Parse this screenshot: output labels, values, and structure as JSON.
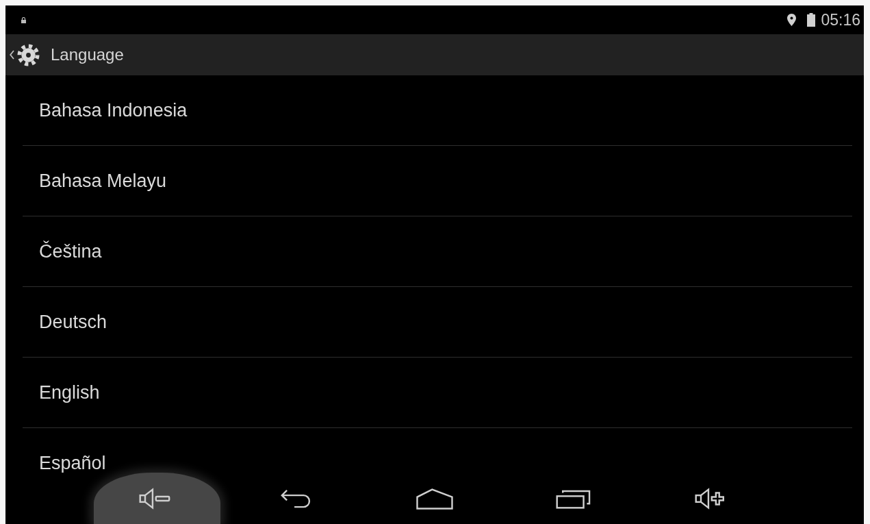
{
  "status_bar": {
    "time": "05:16"
  },
  "action_bar": {
    "title": "Language"
  },
  "languages": [
    {
      "label": "Bahasa Indonesia"
    },
    {
      "label": "Bahasa Melayu"
    },
    {
      "label": "Čeština"
    },
    {
      "label": "Deutsch"
    },
    {
      "label": "English"
    },
    {
      "label": "Español"
    }
  ],
  "nav_bar": {
    "buttons": [
      {
        "kind": "volume-down",
        "pressed": true
      },
      {
        "kind": "back",
        "pressed": false
      },
      {
        "kind": "home",
        "pressed": false
      },
      {
        "kind": "recents",
        "pressed": false
      },
      {
        "kind": "volume-up",
        "pressed": false
      }
    ]
  }
}
